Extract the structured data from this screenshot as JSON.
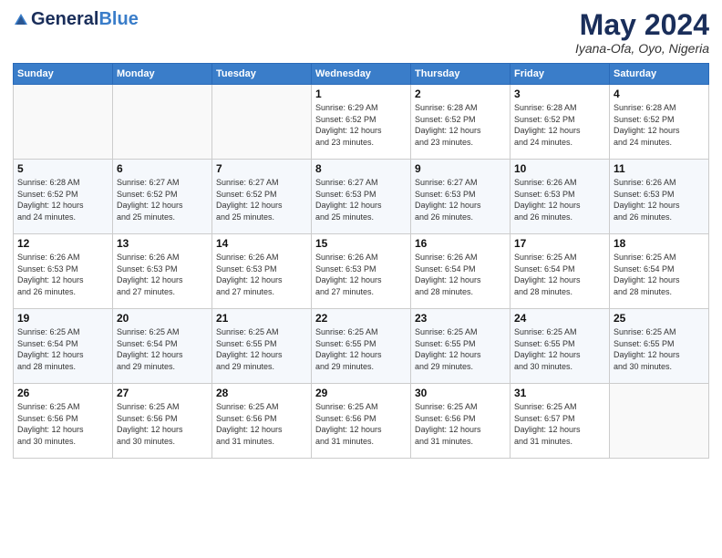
{
  "header": {
    "logo_line1": "General",
    "logo_line2": "Blue",
    "month": "May 2024",
    "location": "Iyana-Ofa, Oyo, Nigeria"
  },
  "weekdays": [
    "Sunday",
    "Monday",
    "Tuesday",
    "Wednesday",
    "Thursday",
    "Friday",
    "Saturday"
  ],
  "weeks": [
    [
      {
        "day": "",
        "info": ""
      },
      {
        "day": "",
        "info": ""
      },
      {
        "day": "",
        "info": ""
      },
      {
        "day": "1",
        "info": "Sunrise: 6:29 AM\nSunset: 6:52 PM\nDaylight: 12 hours\nand 23 minutes."
      },
      {
        "day": "2",
        "info": "Sunrise: 6:28 AM\nSunset: 6:52 PM\nDaylight: 12 hours\nand 23 minutes."
      },
      {
        "day": "3",
        "info": "Sunrise: 6:28 AM\nSunset: 6:52 PM\nDaylight: 12 hours\nand 24 minutes."
      },
      {
        "day": "4",
        "info": "Sunrise: 6:28 AM\nSunset: 6:52 PM\nDaylight: 12 hours\nand 24 minutes."
      }
    ],
    [
      {
        "day": "5",
        "info": "Sunrise: 6:28 AM\nSunset: 6:52 PM\nDaylight: 12 hours\nand 24 minutes."
      },
      {
        "day": "6",
        "info": "Sunrise: 6:27 AM\nSunset: 6:52 PM\nDaylight: 12 hours\nand 25 minutes."
      },
      {
        "day": "7",
        "info": "Sunrise: 6:27 AM\nSunset: 6:52 PM\nDaylight: 12 hours\nand 25 minutes."
      },
      {
        "day": "8",
        "info": "Sunrise: 6:27 AM\nSunset: 6:53 PM\nDaylight: 12 hours\nand 25 minutes."
      },
      {
        "day": "9",
        "info": "Sunrise: 6:27 AM\nSunset: 6:53 PM\nDaylight: 12 hours\nand 26 minutes."
      },
      {
        "day": "10",
        "info": "Sunrise: 6:26 AM\nSunset: 6:53 PM\nDaylight: 12 hours\nand 26 minutes."
      },
      {
        "day": "11",
        "info": "Sunrise: 6:26 AM\nSunset: 6:53 PM\nDaylight: 12 hours\nand 26 minutes."
      }
    ],
    [
      {
        "day": "12",
        "info": "Sunrise: 6:26 AM\nSunset: 6:53 PM\nDaylight: 12 hours\nand 26 minutes."
      },
      {
        "day": "13",
        "info": "Sunrise: 6:26 AM\nSunset: 6:53 PM\nDaylight: 12 hours\nand 27 minutes."
      },
      {
        "day": "14",
        "info": "Sunrise: 6:26 AM\nSunset: 6:53 PM\nDaylight: 12 hours\nand 27 minutes."
      },
      {
        "day": "15",
        "info": "Sunrise: 6:26 AM\nSunset: 6:53 PM\nDaylight: 12 hours\nand 27 minutes."
      },
      {
        "day": "16",
        "info": "Sunrise: 6:26 AM\nSunset: 6:54 PM\nDaylight: 12 hours\nand 28 minutes."
      },
      {
        "day": "17",
        "info": "Sunrise: 6:25 AM\nSunset: 6:54 PM\nDaylight: 12 hours\nand 28 minutes."
      },
      {
        "day": "18",
        "info": "Sunrise: 6:25 AM\nSunset: 6:54 PM\nDaylight: 12 hours\nand 28 minutes."
      }
    ],
    [
      {
        "day": "19",
        "info": "Sunrise: 6:25 AM\nSunset: 6:54 PM\nDaylight: 12 hours\nand 28 minutes."
      },
      {
        "day": "20",
        "info": "Sunrise: 6:25 AM\nSunset: 6:54 PM\nDaylight: 12 hours\nand 29 minutes."
      },
      {
        "day": "21",
        "info": "Sunrise: 6:25 AM\nSunset: 6:55 PM\nDaylight: 12 hours\nand 29 minutes."
      },
      {
        "day": "22",
        "info": "Sunrise: 6:25 AM\nSunset: 6:55 PM\nDaylight: 12 hours\nand 29 minutes."
      },
      {
        "day": "23",
        "info": "Sunrise: 6:25 AM\nSunset: 6:55 PM\nDaylight: 12 hours\nand 29 minutes."
      },
      {
        "day": "24",
        "info": "Sunrise: 6:25 AM\nSunset: 6:55 PM\nDaylight: 12 hours\nand 30 minutes."
      },
      {
        "day": "25",
        "info": "Sunrise: 6:25 AM\nSunset: 6:55 PM\nDaylight: 12 hours\nand 30 minutes."
      }
    ],
    [
      {
        "day": "26",
        "info": "Sunrise: 6:25 AM\nSunset: 6:56 PM\nDaylight: 12 hours\nand 30 minutes."
      },
      {
        "day": "27",
        "info": "Sunrise: 6:25 AM\nSunset: 6:56 PM\nDaylight: 12 hours\nand 30 minutes."
      },
      {
        "day": "28",
        "info": "Sunrise: 6:25 AM\nSunset: 6:56 PM\nDaylight: 12 hours\nand 31 minutes."
      },
      {
        "day": "29",
        "info": "Sunrise: 6:25 AM\nSunset: 6:56 PM\nDaylight: 12 hours\nand 31 minutes."
      },
      {
        "day": "30",
        "info": "Sunrise: 6:25 AM\nSunset: 6:56 PM\nDaylight: 12 hours\nand 31 minutes."
      },
      {
        "day": "31",
        "info": "Sunrise: 6:25 AM\nSunset: 6:57 PM\nDaylight: 12 hours\nand 31 minutes."
      },
      {
        "day": "",
        "info": ""
      }
    ]
  ]
}
